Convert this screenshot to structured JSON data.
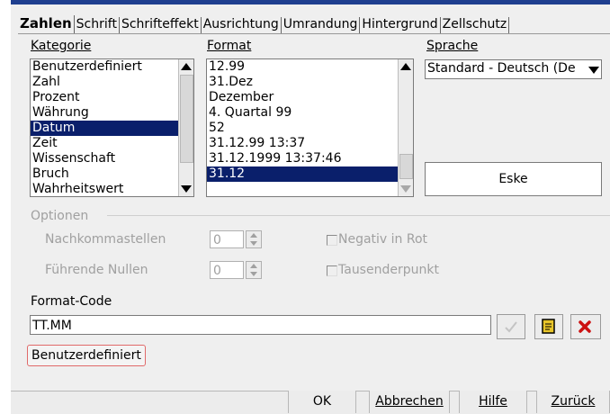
{
  "tabs": [
    "Zahlen",
    "Schrift",
    "Schrifteffekt",
    "Ausrichtung",
    "Umrandung",
    "Hintergrund",
    "Zellschutz"
  ],
  "kategorie": {
    "label": "Kategorie",
    "items": [
      "Benutzerdefiniert",
      "Zahl",
      "Prozent",
      "Währung",
      "Datum",
      "Zeit",
      "Wissenschaft",
      "Bruch",
      "Wahrheitswert"
    ],
    "selected": "Datum"
  },
  "format": {
    "label": "Format",
    "items": [
      "12.99",
      "31.Dez",
      "Dezember",
      "4. Quartal 99",
      "52",
      "31.12.99 13:37",
      "31.12.1999 13:37:46",
      "31.12"
    ],
    "selected": "31.12"
  },
  "sprache": {
    "label": "Sprache",
    "value": "Standard - Deutsch (De"
  },
  "preview": {
    "text": "Eske"
  },
  "optionen": {
    "title": "Optionen",
    "nachkommastellen_label": "Nachkommastellen",
    "nachkommastellen_value": "0",
    "fuehrende_nullen_label": "Führende Nullen",
    "fuehrende_nullen_value": "0",
    "negativ_label": "Negativ in Rot",
    "tausender_label": "Tausenderpunkt"
  },
  "format_code": {
    "label": "Format-Code",
    "value": "TT.MM",
    "status": "Benutzerdefiniert"
  },
  "buttons": {
    "ok": "OK",
    "abbrechen": "Abbrechen",
    "hilfe": "Hilfe",
    "zurueck": "Zurück"
  },
  "colors": {
    "selection": "#0a1f6b",
    "title_bar": "#1f3f8f",
    "badge_border": "#e06a6a",
    "delete_icon": "#cc1111",
    "note_icon": "#e8c52a"
  }
}
